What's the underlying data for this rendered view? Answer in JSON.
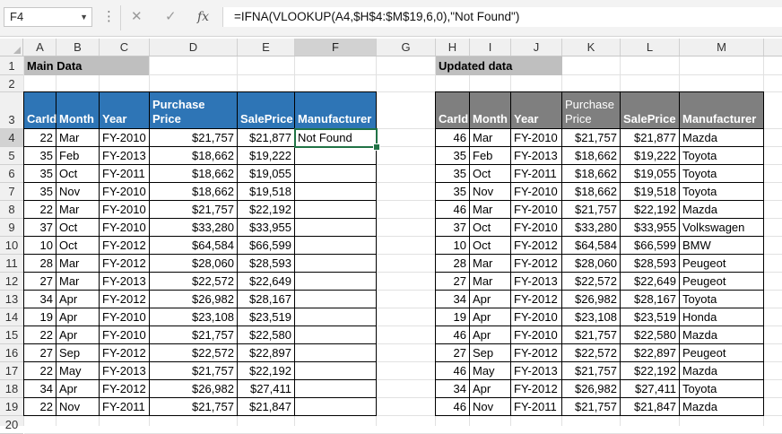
{
  "name_box": "F4",
  "formula": "=IFNA(VLOOKUP(A4,$H$4:$M$19,6,0),\"Not Found\")",
  "fx_label": "fx",
  "columns": [
    "A",
    "B",
    "C",
    "D",
    "E",
    "F",
    "G",
    "H",
    "I",
    "J",
    "K",
    "L",
    "M"
  ],
  "rows": [
    "1",
    "2",
    "3",
    "4",
    "5",
    "6",
    "7",
    "8",
    "9",
    "10",
    "11",
    "12",
    "13",
    "14",
    "15",
    "16",
    "17",
    "18",
    "19",
    "20"
  ],
  "main_title": "Main Data",
  "updated_title": "Updated data",
  "main_headers": [
    "CarId",
    "Month",
    "Year",
    "Purchase Price",
    "SalePrice",
    "Manufacturer"
  ],
  "updated_headers": [
    "CarId",
    "Month",
    "Year",
    "Purchase\nPrice",
    "SalePrice",
    "Manufacturer"
  ],
  "updated_headers_k": [
    "Purchase",
    "Price"
  ],
  "main_rows": [
    [
      "22",
      "Mar",
      "FY-2010",
      "$21,757",
      "$21,877",
      "Not Found"
    ],
    [
      "35",
      "Feb",
      "FY-2013",
      "$18,662",
      "$19,222",
      ""
    ],
    [
      "35",
      "Oct",
      "FY-2011",
      "$18,662",
      "$19,055",
      ""
    ],
    [
      "35",
      "Nov",
      "FY-2010",
      "$18,662",
      "$19,518",
      ""
    ],
    [
      "22",
      "Mar",
      "FY-2010",
      "$21,757",
      "$22,192",
      ""
    ],
    [
      "37",
      "Oct",
      "FY-2010",
      "$33,280",
      "$33,955",
      ""
    ],
    [
      "10",
      "Oct",
      "FY-2012",
      "$64,584",
      "$66,599",
      ""
    ],
    [
      "28",
      "Mar",
      "FY-2012",
      "$28,060",
      "$28,593",
      ""
    ],
    [
      "27",
      "Mar",
      "FY-2013",
      "$22,572",
      "$22,649",
      ""
    ],
    [
      "34",
      "Apr",
      "FY-2012",
      "$26,982",
      "$28,167",
      ""
    ],
    [
      "19",
      "Apr",
      "FY-2010",
      "$23,108",
      "$23,519",
      ""
    ],
    [
      "22",
      "Apr",
      "FY-2010",
      "$21,757",
      "$22,580",
      ""
    ],
    [
      "27",
      "Sep",
      "FY-2012",
      "$22,572",
      "$22,897",
      ""
    ],
    [
      "22",
      "May",
      "FY-2013",
      "$21,757",
      "$22,192",
      ""
    ],
    [
      "34",
      "Apr",
      "FY-2012",
      "$26,982",
      "$27,411",
      ""
    ],
    [
      "22",
      "Nov",
      "FY-2011",
      "$21,757",
      "$21,847",
      ""
    ]
  ],
  "updated_rows": [
    [
      "46",
      "Mar",
      "FY-2010",
      "$21,757",
      "$21,877",
      "Mazda"
    ],
    [
      "35",
      "Feb",
      "FY-2013",
      "$18,662",
      "$19,222",
      "Toyota"
    ],
    [
      "35",
      "Oct",
      "FY-2011",
      "$18,662",
      "$19,055",
      "Toyota"
    ],
    [
      "35",
      "Nov",
      "FY-2010",
      "$18,662",
      "$19,518",
      "Toyota"
    ],
    [
      "46",
      "Mar",
      "FY-2010",
      "$21,757",
      "$22,192",
      "Mazda"
    ],
    [
      "37",
      "Oct",
      "FY-2010",
      "$33,280",
      "$33,955",
      "Volkswagen"
    ],
    [
      "10",
      "Oct",
      "FY-2012",
      "$64,584",
      "$66,599",
      "BMW"
    ],
    [
      "28",
      "Mar",
      "FY-2012",
      "$28,060",
      "$28,593",
      "Peugeot"
    ],
    [
      "27",
      "Mar",
      "FY-2013",
      "$22,572",
      "$22,649",
      "Peugeot"
    ],
    [
      "34",
      "Apr",
      "FY-2012",
      "$26,982",
      "$28,167",
      "Toyota"
    ],
    [
      "19",
      "Apr",
      "FY-2010",
      "$23,108",
      "$23,519",
      "Honda"
    ],
    [
      "46",
      "Apr",
      "FY-2010",
      "$21,757",
      "$22,580",
      "Mazda"
    ],
    [
      "27",
      "Sep",
      "FY-2012",
      "$22,572",
      "$22,897",
      "Peugeot"
    ],
    [
      "46",
      "May",
      "FY-2013",
      "$21,757",
      "$22,192",
      "Mazda"
    ],
    [
      "34",
      "Apr",
      "FY-2012",
      "$26,982",
      "$27,411",
      "Toyota"
    ],
    [
      "46",
      "Nov",
      "FY-2011",
      "$21,757",
      "$21,847",
      "Mazda"
    ]
  ],
  "colors": {
    "main_header_bg": "#2e75b6",
    "updated_header_bg": "#7f7f7f",
    "title_bg": "#bfbfbf",
    "selection": "#217346"
  }
}
